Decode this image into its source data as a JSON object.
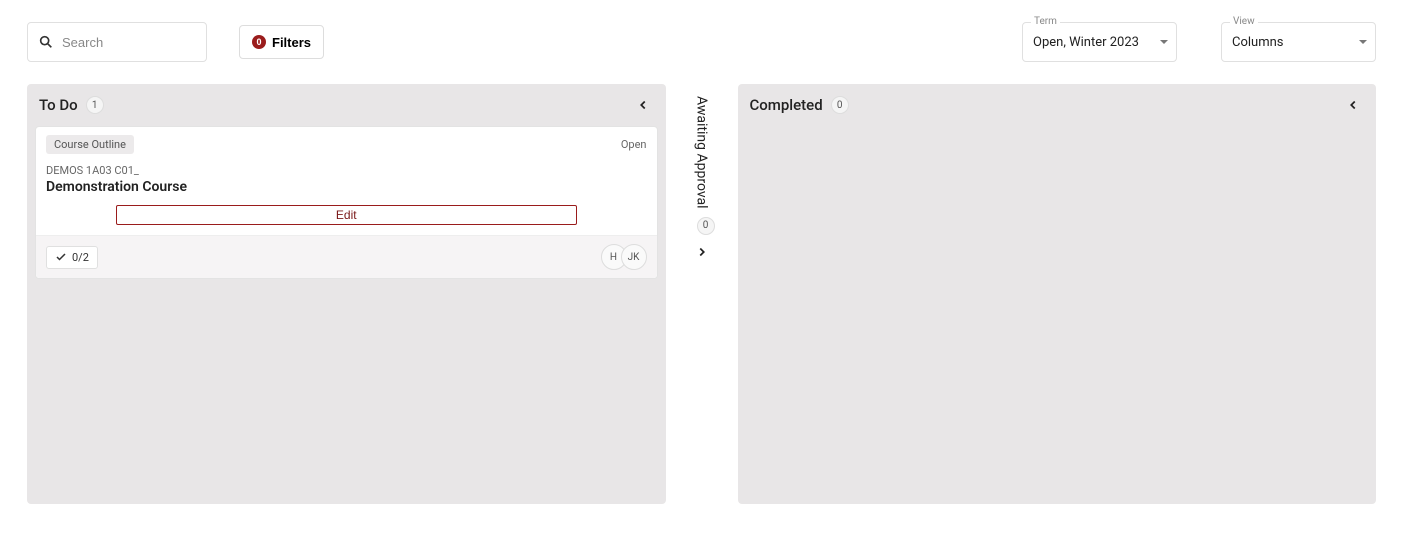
{
  "toolbar": {
    "search_placeholder": "Search",
    "filters_label": "Filters",
    "filters_count": "0",
    "term_label": "Term",
    "term_value": "Open, Winter 2023",
    "view_label": "View",
    "view_value": "Columns"
  },
  "columns": {
    "todo": {
      "title": "To Do",
      "count": "1"
    },
    "awaiting": {
      "title": "Awaiting Approval",
      "count": "0"
    },
    "completed": {
      "title": "Completed",
      "count": "0"
    }
  },
  "card": {
    "tag": "Course Outline",
    "status": "Open",
    "code": "DEMOS 1A03 C01_",
    "title": "Demonstration Course",
    "edit_label": "Edit",
    "checklist": "0/2",
    "avatars": [
      "H",
      "JK"
    ]
  }
}
